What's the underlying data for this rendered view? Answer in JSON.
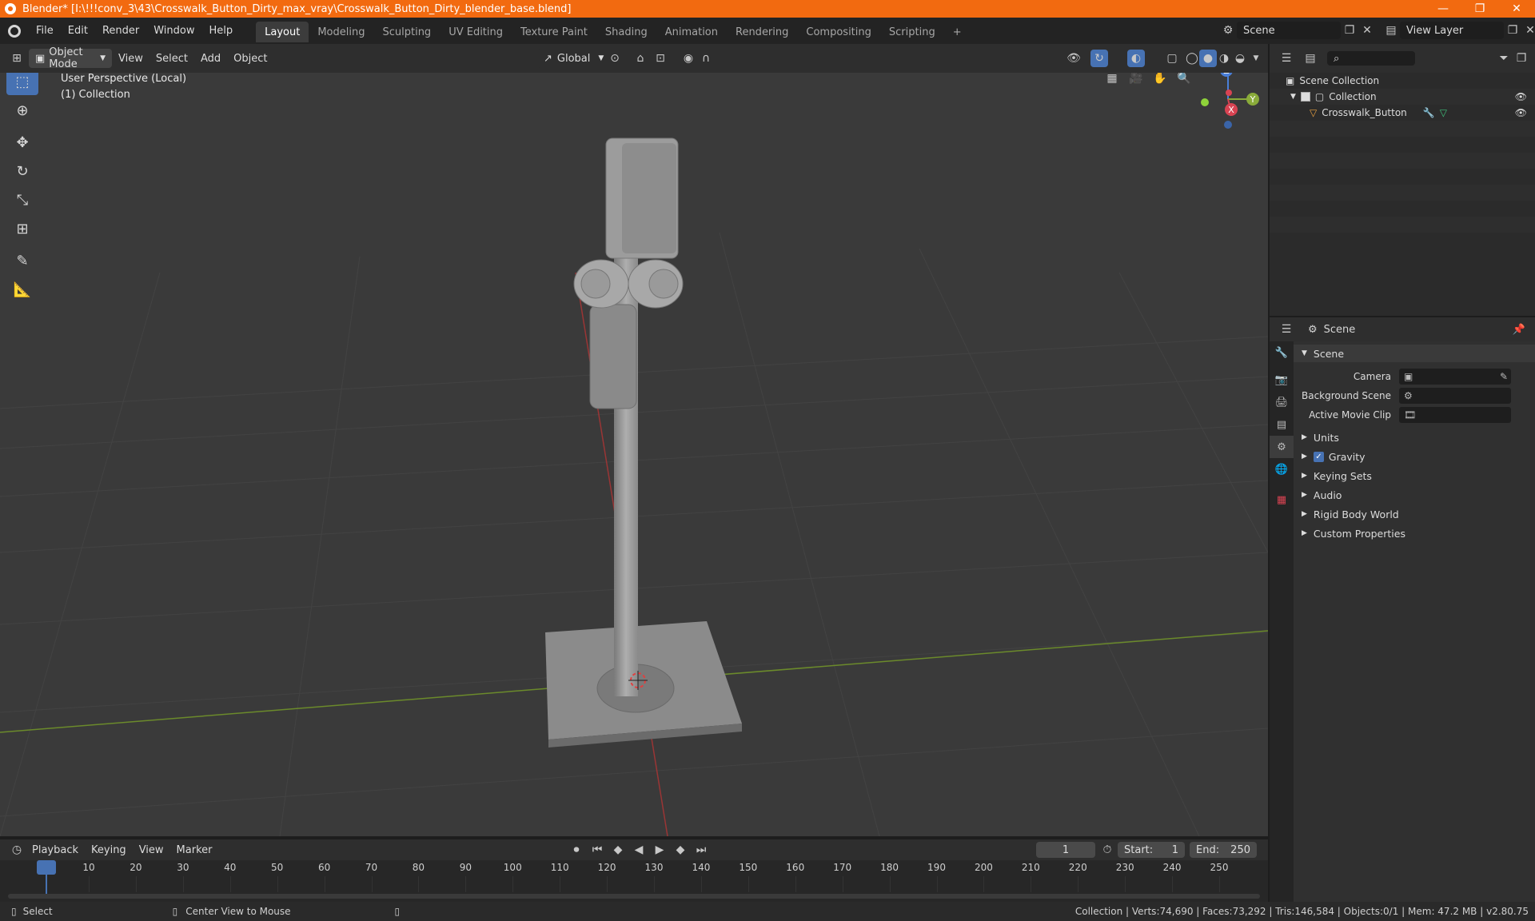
{
  "window": {
    "title": "Blender* [I:\\!!!conv_3\\43\\Crosswalk_Button_Dirty_max_vray\\Crosswalk_Button_Dirty_blender_base.blend]",
    "minimize": "—",
    "maximize": "❐",
    "close": "✕"
  },
  "menu": [
    "File",
    "Edit",
    "Render",
    "Window",
    "Help"
  ],
  "workspaces": [
    "Layout",
    "Modeling",
    "Sculpting",
    "UV Editing",
    "Texture Paint",
    "Shading",
    "Animation",
    "Rendering",
    "Compositing",
    "Scripting"
  ],
  "workspace_add": "+",
  "scene_field": "Scene",
  "view_layer_field": "View Layer",
  "viewport_header": {
    "mode": "Object Mode",
    "view": "View",
    "select": "Select",
    "add": "Add",
    "object": "Object",
    "transform": "Global"
  },
  "viewport": {
    "perspective": "User Perspective (Local)",
    "collection": "(1) Collection"
  },
  "gizmo": {
    "z": "Z",
    "y": "Y",
    "x": "X"
  },
  "outliner": {
    "root": "Scene Collection",
    "collection": "Collection",
    "object": "Crosswalk_Button"
  },
  "properties": {
    "header": "Scene",
    "panel": "Scene",
    "camera_label": "Camera",
    "bg_scene_label": "Background Scene",
    "movie_clip_label": "Active Movie Clip",
    "sections": [
      "Units",
      "Gravity",
      "Keying Sets",
      "Audio",
      "Rigid Body World",
      "Custom Properties"
    ]
  },
  "timeline_header": {
    "playback": "Playback",
    "keying": "Keying",
    "view": "View",
    "marker": "Marker",
    "current_frame": "1",
    "start_label": "Start:",
    "start": "1",
    "end_label": "End:",
    "end": "250"
  },
  "timeline_ticks": [
    "1",
    "10",
    "20",
    "30",
    "40",
    "50",
    "60",
    "70",
    "80",
    "90",
    "100",
    "110",
    "120",
    "130",
    "140",
    "150",
    "160",
    "170",
    "180",
    "190",
    "200",
    "210",
    "220",
    "230",
    "240",
    "250"
  ],
  "statusbar": {
    "select": "Select",
    "center": "Center View to Mouse",
    "stats": "Collection | Verts:74,690 | Faces:73,292 | Tris:146,584 | Objects:0/1 | Mem: 47.2 MB | v2.80.75"
  },
  "colors": {
    "titlebar": "#f26a10",
    "accent": "#4772b3",
    "axis_x": "#d84352",
    "axis_y": "#8aab3a",
    "axis_z": "#4a7fd8"
  }
}
